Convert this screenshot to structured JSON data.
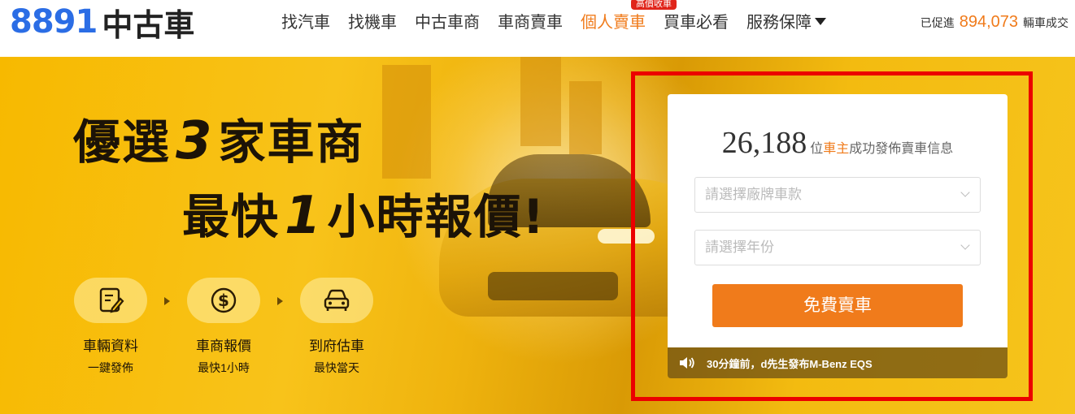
{
  "header": {
    "logo_number": "8891",
    "logo_text": "中古車",
    "nav": [
      {
        "label": "找汽車"
      },
      {
        "label": "找機車"
      },
      {
        "label": "中古車商"
      },
      {
        "label": "車商賣車"
      },
      {
        "label": "個人賣車",
        "badge": "高價收車",
        "active": true
      },
      {
        "label": "買車必看"
      },
      {
        "label": "服務保障"
      }
    ],
    "deals_prefix": "已促進",
    "deals_count": "894,073",
    "deals_suffix": "輛車成交"
  },
  "hero": {
    "line1_a": "優選",
    "line1_num": "3",
    "line1_b": "家車商",
    "line2_a": "最快",
    "line2_num": "1",
    "line2_b": "小時報價!",
    "steps": [
      {
        "icon": "edit-document-icon",
        "title": "車輛資料",
        "sub": "一鍵發佈"
      },
      {
        "icon": "dollar-coin-icon",
        "title": "車商報價",
        "sub": "最快1小時"
      },
      {
        "icon": "car-front-icon",
        "title": "到府估車",
        "sub": "最快當天"
      }
    ]
  },
  "card": {
    "count": "26,188",
    "stat_prefix": "位",
    "stat_owner": "車主",
    "stat_suffix": "成功發佈賣車信息",
    "brand_placeholder": "請選擇廠牌車款",
    "year_placeholder": "請選擇年份",
    "sell_button": "免費賣車",
    "ticker": "30分鐘前，d先生發布M-Benz EQS"
  },
  "colors": {
    "brand_blue": "#2b6de5",
    "accent_orange": "#f07b1b",
    "badge_red": "#e0251b",
    "highlight_frame": "#ec0000",
    "hero_yellow": "#f7b900"
  }
}
